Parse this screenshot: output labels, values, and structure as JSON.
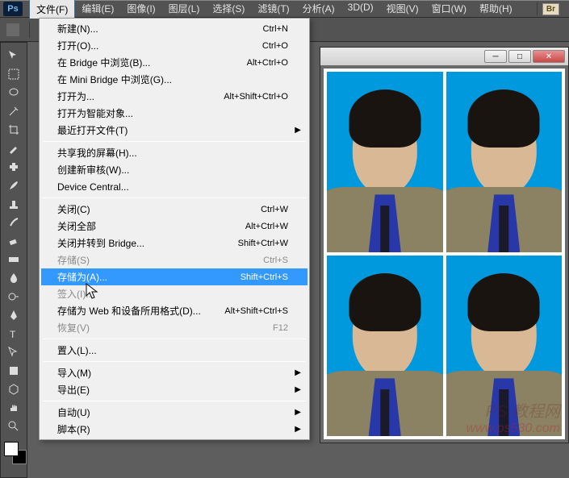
{
  "app": {
    "logo": "Ps"
  },
  "menubar": {
    "items": [
      "文件(F)",
      "编辑(E)",
      "图像(I)",
      "图层(L)",
      "选择(S)",
      "滤镜(T)",
      "分析(A)",
      "3D(D)",
      "视图(V)",
      "窗口(W)",
      "帮助(H)"
    ],
    "br_label": "Br"
  },
  "file_menu": {
    "groups": [
      [
        {
          "label": "新建(N)...",
          "shortcut": "Ctrl+N",
          "enabled": true
        },
        {
          "label": "打开(O)...",
          "shortcut": "Ctrl+O",
          "enabled": true
        },
        {
          "label": "在 Bridge 中浏览(B)...",
          "shortcut": "Alt+Ctrl+O",
          "enabled": true
        },
        {
          "label": "在 Mini Bridge 中浏览(G)...",
          "shortcut": "",
          "enabled": true
        },
        {
          "label": "打开为...",
          "shortcut": "Alt+Shift+Ctrl+O",
          "enabled": true
        },
        {
          "label": "打开为智能对象...",
          "shortcut": "",
          "enabled": true
        },
        {
          "label": "最近打开文件(T)",
          "shortcut": "",
          "enabled": true,
          "submenu": true
        }
      ],
      [
        {
          "label": "共享我的屏幕(H)...",
          "shortcut": "",
          "enabled": true
        },
        {
          "label": "创建新审核(W)...",
          "shortcut": "",
          "enabled": true
        },
        {
          "label": "Device Central...",
          "shortcut": "",
          "enabled": true
        }
      ],
      [
        {
          "label": "关闭(C)",
          "shortcut": "Ctrl+W",
          "enabled": true
        },
        {
          "label": "关闭全部",
          "shortcut": "Alt+Ctrl+W",
          "enabled": true
        },
        {
          "label": "关闭并转到 Bridge...",
          "shortcut": "Shift+Ctrl+W",
          "enabled": true
        },
        {
          "label": "存储(S)",
          "shortcut": "Ctrl+S",
          "enabled": false
        },
        {
          "label": "存储为(A)...",
          "shortcut": "Shift+Ctrl+S",
          "enabled": true,
          "highlight": true
        },
        {
          "label": "签入(I)...",
          "shortcut": "",
          "enabled": false
        },
        {
          "label": "存储为 Web 和设备所用格式(D)...",
          "shortcut": "Alt+Shift+Ctrl+S",
          "enabled": true
        },
        {
          "label": "恢复(V)",
          "shortcut": "F12",
          "enabled": false
        }
      ],
      [
        {
          "label": "置入(L)...",
          "shortcut": "",
          "enabled": true
        }
      ],
      [
        {
          "label": "导入(M)",
          "shortcut": "",
          "enabled": true,
          "submenu": true
        },
        {
          "label": "导出(E)",
          "shortcut": "",
          "enabled": true,
          "submenu": true
        }
      ],
      [
        {
          "label": "自动(U)",
          "shortcut": "",
          "enabled": true,
          "submenu": true
        },
        {
          "label": "脚本(R)",
          "shortcut": "",
          "enabled": true,
          "submenu": true
        }
      ]
    ]
  },
  "watermark": {
    "line1": "PS 教程网",
    "line2": "www.ps530.com"
  }
}
